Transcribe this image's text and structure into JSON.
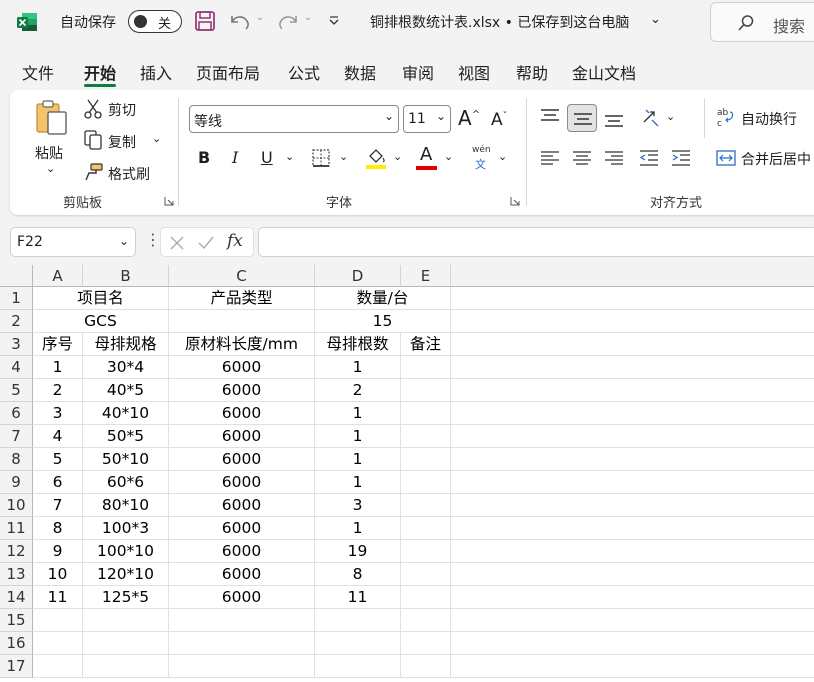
{
  "titlebar": {
    "autosave_label": "自动保存",
    "autosave_state": "关",
    "file_title": "铜排根数统计表.xlsx • 已保存到这台电脑",
    "search_label": "搜索"
  },
  "tabs": [
    "文件",
    "开始",
    "插入",
    "页面布局",
    "公式",
    "数据",
    "审阅",
    "视图",
    "帮助",
    "金山文档"
  ],
  "active_tab": "开始",
  "ribbon": {
    "clipboard": {
      "paste": "粘贴",
      "cut": "剪切",
      "copy": "复制",
      "format_painter": "格式刷",
      "group": "剪贴板"
    },
    "font": {
      "font_name": "等线",
      "font_size": "11",
      "bold": "B",
      "italic": "I",
      "underline": "U",
      "font_color_glyph": "A",
      "phonetic_top": "wén",
      "phonetic_bottom": "文",
      "group": "字体"
    },
    "alignment": {
      "wrap_text": "自动换行",
      "merge_center": "合并后居中",
      "group": "对齐方式"
    },
    "accent_color": "#107c41"
  },
  "formula_bar": {
    "name_box": "F22",
    "fx": "fx",
    "formula": ""
  },
  "sheet": {
    "columns": [
      "A",
      "B",
      "C",
      "D",
      "E"
    ],
    "row_numbers": [
      "1",
      "2",
      "3",
      "4",
      "5",
      "6",
      "7",
      "8",
      "9",
      "10",
      "11",
      "12",
      "13",
      "14",
      "15",
      "16",
      "17"
    ],
    "rows": [
      {
        "merged": [
          {
            "text": "项目名",
            "span": "AB"
          },
          {
            "text": "产品类型",
            "span": "C"
          },
          {
            "text": "数量/台",
            "span": "DE"
          }
        ]
      },
      {
        "merged": [
          {
            "text": "GCS",
            "span": "AB"
          },
          {
            "text": "",
            "span": "C"
          },
          {
            "text": "15",
            "span": "DE"
          }
        ]
      },
      {
        "cells": [
          "序号",
          "母排规格",
          "原材料长度/mm",
          "母排根数",
          "备注"
        ]
      },
      {
        "cells": [
          "1",
          "30*4",
          "6000",
          "1",
          ""
        ]
      },
      {
        "cells": [
          "2",
          "40*5",
          "6000",
          "2",
          ""
        ]
      },
      {
        "cells": [
          "3",
          "40*10",
          "6000",
          "1",
          ""
        ]
      },
      {
        "cells": [
          "4",
          "50*5",
          "6000",
          "1",
          ""
        ]
      },
      {
        "cells": [
          "5",
          "50*10",
          "6000",
          "1",
          ""
        ]
      },
      {
        "cells": [
          "6",
          "60*6",
          "6000",
          "1",
          ""
        ]
      },
      {
        "cells": [
          "7",
          "80*10",
          "6000",
          "3",
          ""
        ]
      },
      {
        "cells": [
          "8",
          "100*3",
          "6000",
          "1",
          ""
        ]
      },
      {
        "cells": [
          "9",
          "100*10",
          "6000",
          "19",
          ""
        ]
      },
      {
        "cells": [
          "10",
          "120*10",
          "6000",
          "8",
          ""
        ]
      },
      {
        "cells": [
          "11",
          "125*5",
          "6000",
          "11",
          ""
        ]
      },
      {
        "cells": [
          "",
          "",
          "",
          "",
          ""
        ]
      },
      {
        "cells": [
          "",
          "",
          "",
          "",
          ""
        ]
      },
      {
        "cells": [
          "",
          "",
          "",
          "",
          ""
        ]
      }
    ]
  }
}
